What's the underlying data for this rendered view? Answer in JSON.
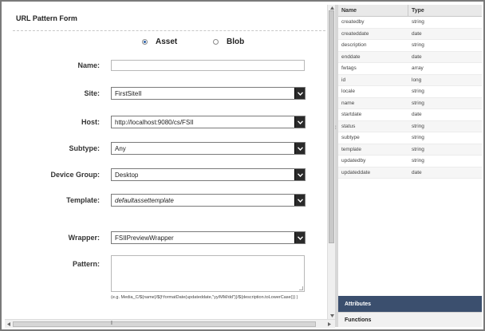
{
  "form": {
    "title": "URL Pattern Form",
    "radio_asset_label": "Asset",
    "radio_blob_label": "Blob",
    "name_label": "Name:",
    "name_value": "",
    "site_label": "Site:",
    "site_value": "FirstSiteII",
    "host_label": "Host:",
    "host_value": "http://localhost:9080/cs/FSII",
    "subtype_label": "Subtype:",
    "subtype_value": "Any",
    "device_group_label": "Device Group:",
    "device_group_value": "Desktop",
    "template_label": "Template:",
    "template_value": "defaultassettemplate",
    "wrapper_label": "Wrapper:",
    "wrapper_value": "FSIIPreviewWrapper",
    "pattern_label": "Pattern:",
    "pattern_value": "",
    "pattern_hint": "(e.g. Media_C/${name}/${f:formatDate(updateddate,\"yy/MM/dd\")}/${description.toLowerCase()} )"
  },
  "properties": {
    "header_name": "Name",
    "header_type": "Type",
    "rows": [
      {
        "name": "createdby",
        "type": "string"
      },
      {
        "name": "createddate",
        "type": "date"
      },
      {
        "name": "description",
        "type": "string"
      },
      {
        "name": "enddate",
        "type": "date"
      },
      {
        "name": "fwtags",
        "type": "array"
      },
      {
        "name": "id",
        "type": "long"
      },
      {
        "name": "locale",
        "type": "string"
      },
      {
        "name": "name",
        "type": "string"
      },
      {
        "name": "startdate",
        "type": "date"
      },
      {
        "name": "status",
        "type": "string"
      },
      {
        "name": "subtype",
        "type": "string"
      },
      {
        "name": "template",
        "type": "string"
      },
      {
        "name": "updatedby",
        "type": "string"
      },
      {
        "name": "updateddate",
        "type": "date"
      }
    ]
  },
  "tabs": {
    "attributes": "Attributes",
    "functions": "Functions"
  },
  "colors": {
    "active_tab": "#3b4f6e",
    "radio_selected": "#2b5fa6",
    "dropdown_button": "#2a2a2a"
  },
  "icons": {
    "dropdown": "chevron-down-icon",
    "scroll_up": "arrow-up-icon",
    "scroll_down": "arrow-down-icon",
    "scroll_left": "arrow-left-icon",
    "scroll_right": "arrow-right-icon"
  }
}
